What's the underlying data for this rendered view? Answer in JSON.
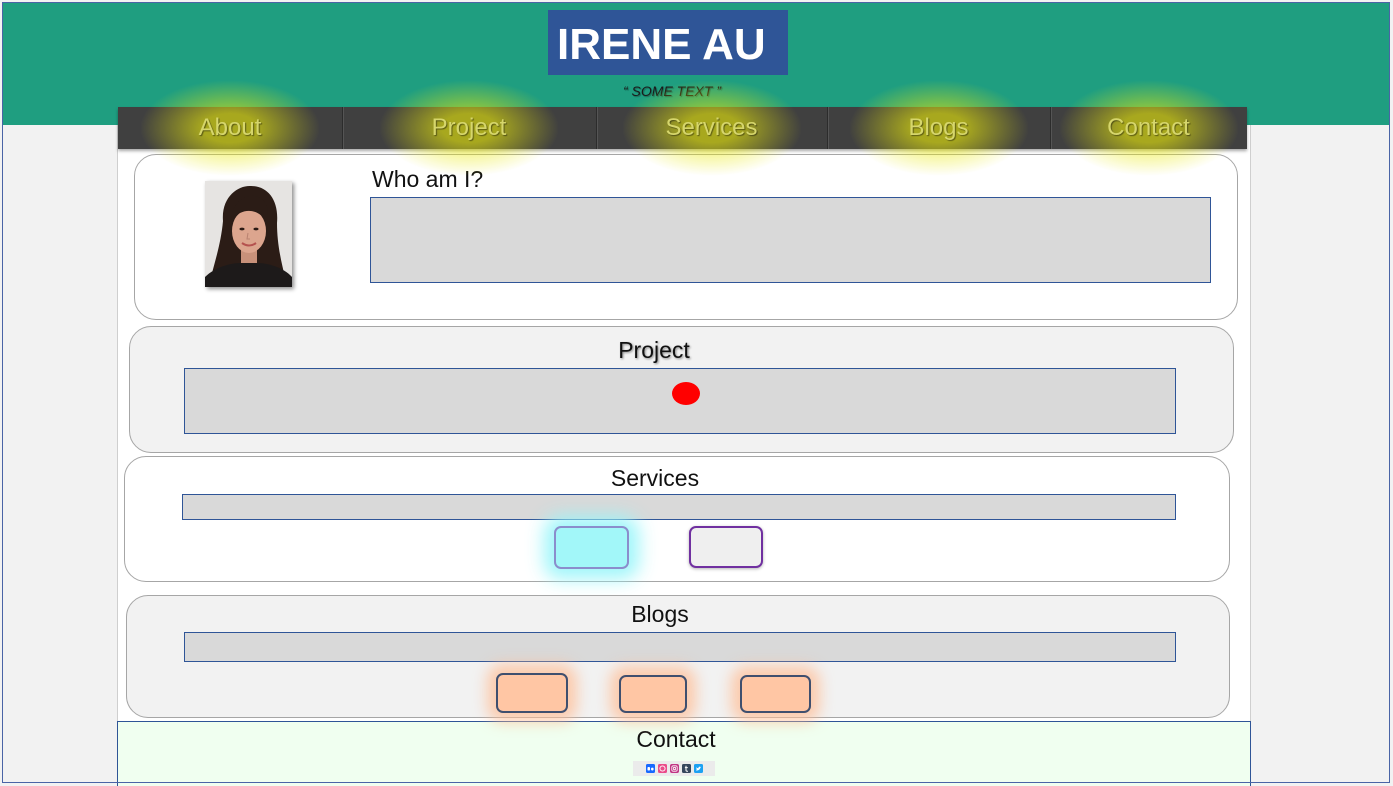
{
  "header": {
    "title": "IRENE AU",
    "subtitle": "“ SOME TEXT ”"
  },
  "nav": {
    "items": [
      {
        "label": "About"
      },
      {
        "label": "Project"
      },
      {
        "label": "Services"
      },
      {
        "label": "Blogs"
      },
      {
        "label": "Contact"
      }
    ]
  },
  "about": {
    "heading": "Who am I?"
  },
  "project": {
    "heading": "Project"
  },
  "services": {
    "heading": "Services"
  },
  "blogs": {
    "heading": "Blogs"
  },
  "contact": {
    "heading": "Contact",
    "social_icons": [
      "behance-icon",
      "dribbble-icon",
      "instagram-icon",
      "tumblr-icon",
      "twitter-icon"
    ]
  },
  "colors": {
    "page_bg": "#f2f2f2",
    "header_bg": "#1f9e80",
    "title_bg": "#2f5597",
    "title_text": "#ffffff",
    "nav_bg": "#404040",
    "nav_text": "#d6d66c",
    "nav_glow": "#e8e80a",
    "box_bg": "#d9d9d9",
    "box_border": "#2f5597",
    "marker": "#ff0000",
    "services_button_primary": "#a2f7f9",
    "services_button_secondary_border": "#7030a0",
    "blog_button": "#ffc6a4",
    "contact_bg": "#f0fff0"
  }
}
